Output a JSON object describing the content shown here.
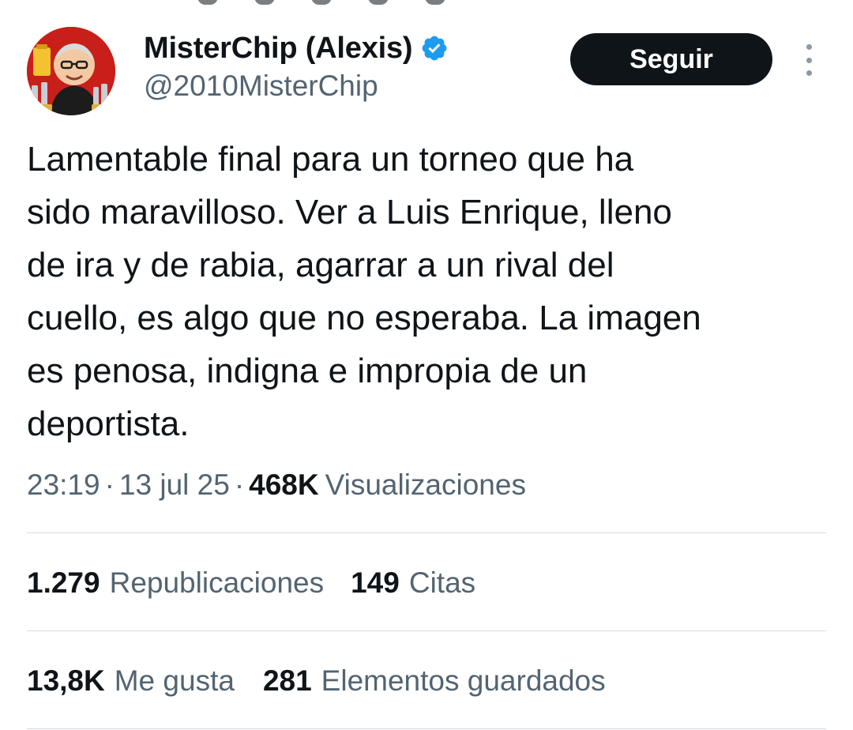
{
  "tweet": {
    "author": {
      "display_name": "MisterChip (Alexis)",
      "handle": "@2010MisterChip",
      "verified": true,
      "avatar_icon": "profile-avatar"
    },
    "follow_label": "Seguir",
    "more_icon": "more-options-icon",
    "text": "Lamentable final para un torneo que ha\nsido maravilloso. Ver a Luis Enrique, lleno\nde ira y de rabia, agarrar a un rival del\ncuello, es algo que no esperaba. La imagen\nes penosa, indigna e impropia de un\ndeportista.",
    "time": "23:19",
    "date": "13 jul 25",
    "separator": "·",
    "views": {
      "count": "468K",
      "label": "Visualizaciones"
    },
    "stats": {
      "reposts": {
        "count": "1.279",
        "label": "Republicaciones"
      },
      "quotes": {
        "count": "149",
        "label": "Citas"
      },
      "likes": {
        "count": "13,8K",
        "label": "Me gusta"
      },
      "bookmarks": {
        "count": "281",
        "label": "Elementos guardados"
      }
    },
    "colors": {
      "text": "#0f1419",
      "secondary": "#536471",
      "verified": "#1d9bf0",
      "button_bg": "#0f1419",
      "divider": "#d6dbe0"
    }
  }
}
